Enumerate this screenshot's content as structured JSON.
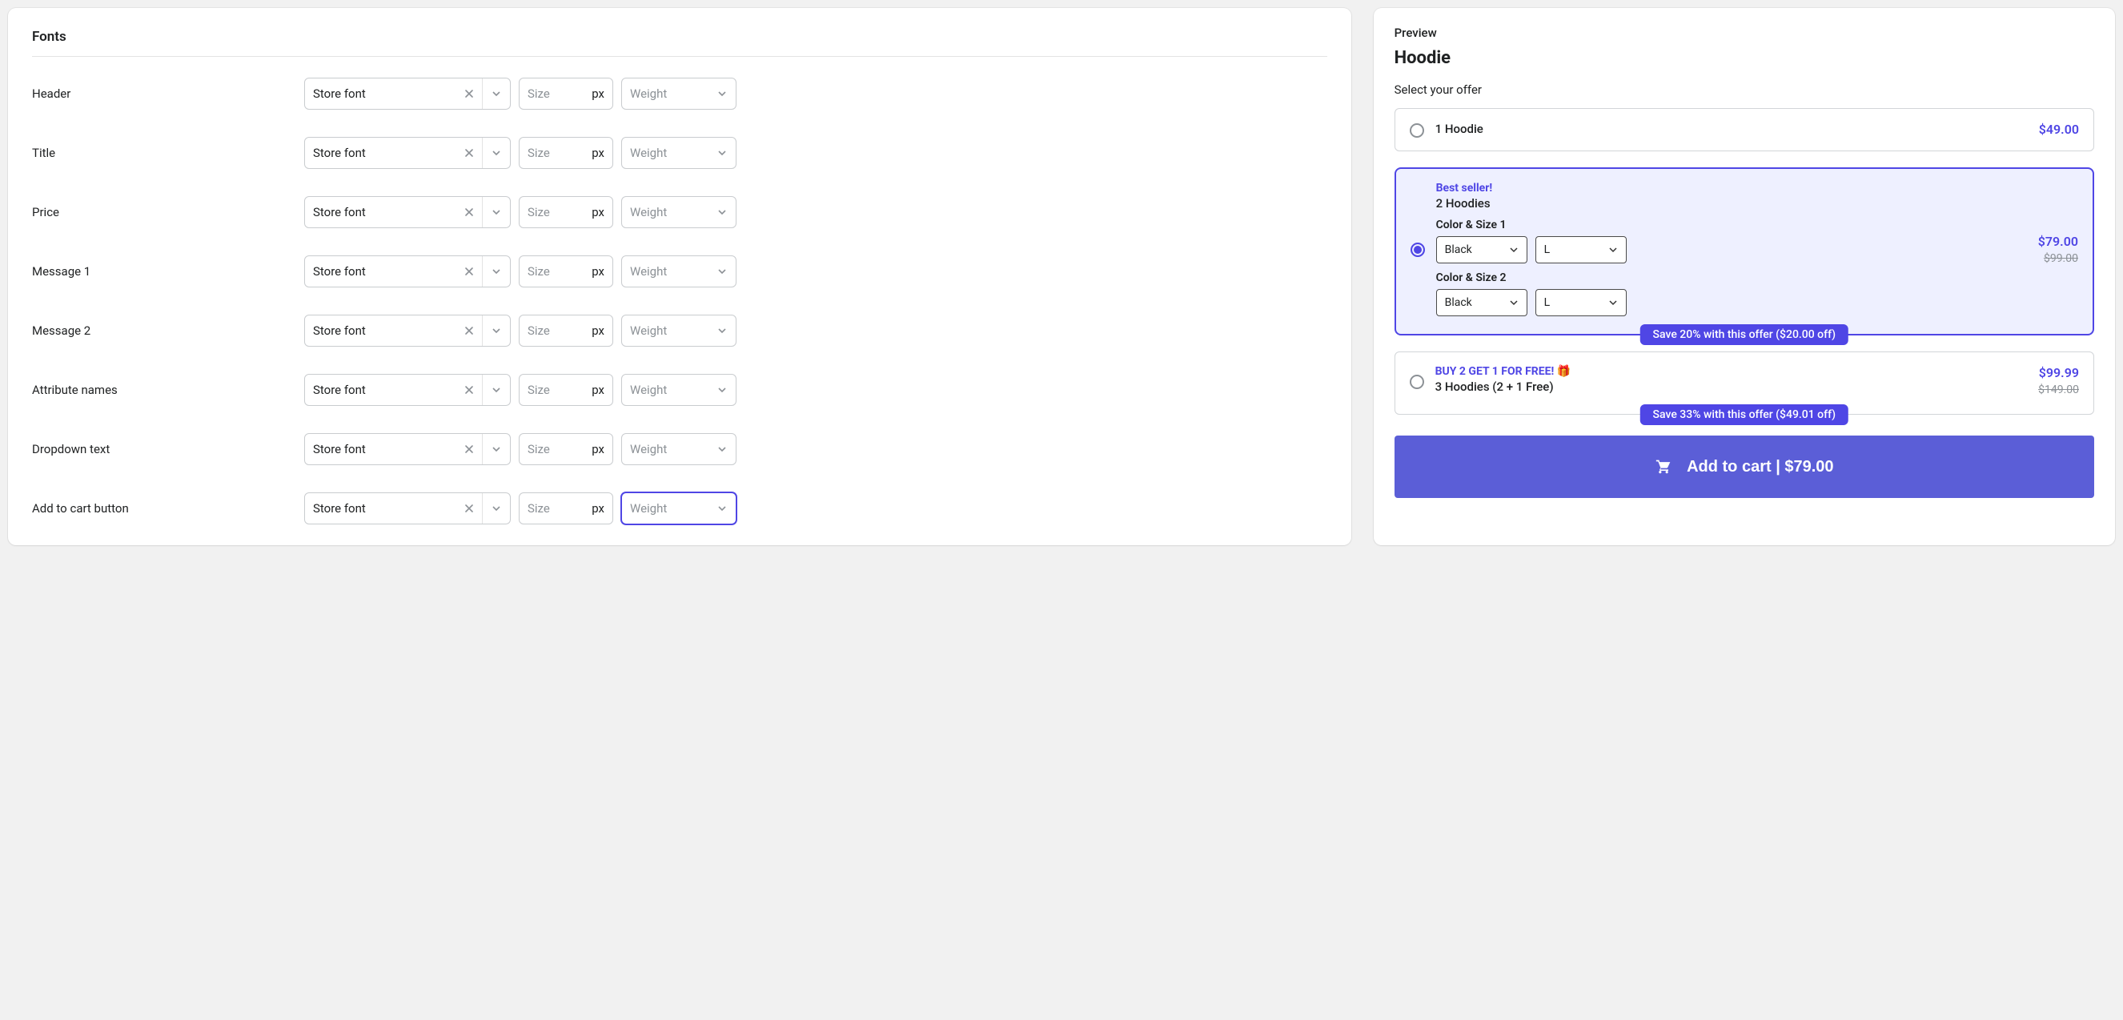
{
  "fonts_section": {
    "title": "Fonts",
    "rows": [
      {
        "label": "Header",
        "font_value": "Store font",
        "size_placeholder": "Size",
        "size_unit": "px",
        "weight_placeholder": "Weight",
        "focused": false
      },
      {
        "label": "Title",
        "font_value": "Store font",
        "size_placeholder": "Size",
        "size_unit": "px",
        "weight_placeholder": "Weight",
        "focused": false
      },
      {
        "label": "Price",
        "font_value": "Store font",
        "size_placeholder": "Size",
        "size_unit": "px",
        "weight_placeholder": "Weight",
        "focused": false
      },
      {
        "label": "Message 1",
        "font_value": "Store font",
        "size_placeholder": "Size",
        "size_unit": "px",
        "weight_placeholder": "Weight",
        "focused": false
      },
      {
        "label": "Message 2",
        "font_value": "Store font",
        "size_placeholder": "Size",
        "size_unit": "px",
        "weight_placeholder": "Weight",
        "focused": false
      },
      {
        "label": "Attribute names",
        "font_value": "Store font",
        "size_placeholder": "Size",
        "size_unit": "px",
        "weight_placeholder": "Weight",
        "focused": false
      },
      {
        "label": "Dropdown text",
        "font_value": "Store font",
        "size_placeholder": "Size",
        "size_unit": "px",
        "weight_placeholder": "Weight",
        "focused": false
      },
      {
        "label": "Add to cart button",
        "font_value": "Store font",
        "size_placeholder": "Size",
        "size_unit": "px",
        "weight_placeholder": "Weight",
        "focused": true
      }
    ]
  },
  "preview": {
    "heading": "Preview",
    "product_name": "Hoodie",
    "select_offer_label": "Select your offer",
    "offers": {
      "offer1": {
        "name": "1 Hoodie",
        "price": "$49.00"
      },
      "offer2": {
        "badge": "Best seller!",
        "name": "2 Hoodies",
        "variant1_label": "Color & Size 1",
        "variant1_color": "Black",
        "variant1_size": "L",
        "variant2_label": "Color & Size 2",
        "variant2_color": "Black",
        "variant2_size": "L",
        "price": "$79.00",
        "compare_price": "$99.00",
        "savings": "Save 20% with this offer ($20.00 off)"
      },
      "offer3": {
        "badge": "BUY 2 GET 1 FOR FREE!",
        "gift": "🎁",
        "name": "3 Hoodies (2 + 1 Free)",
        "price": "$99.99",
        "compare_price": "$149.00",
        "savings": "Save 33% with this offer ($49.01 off)"
      }
    },
    "atc": "Add to cart | $79.00"
  }
}
